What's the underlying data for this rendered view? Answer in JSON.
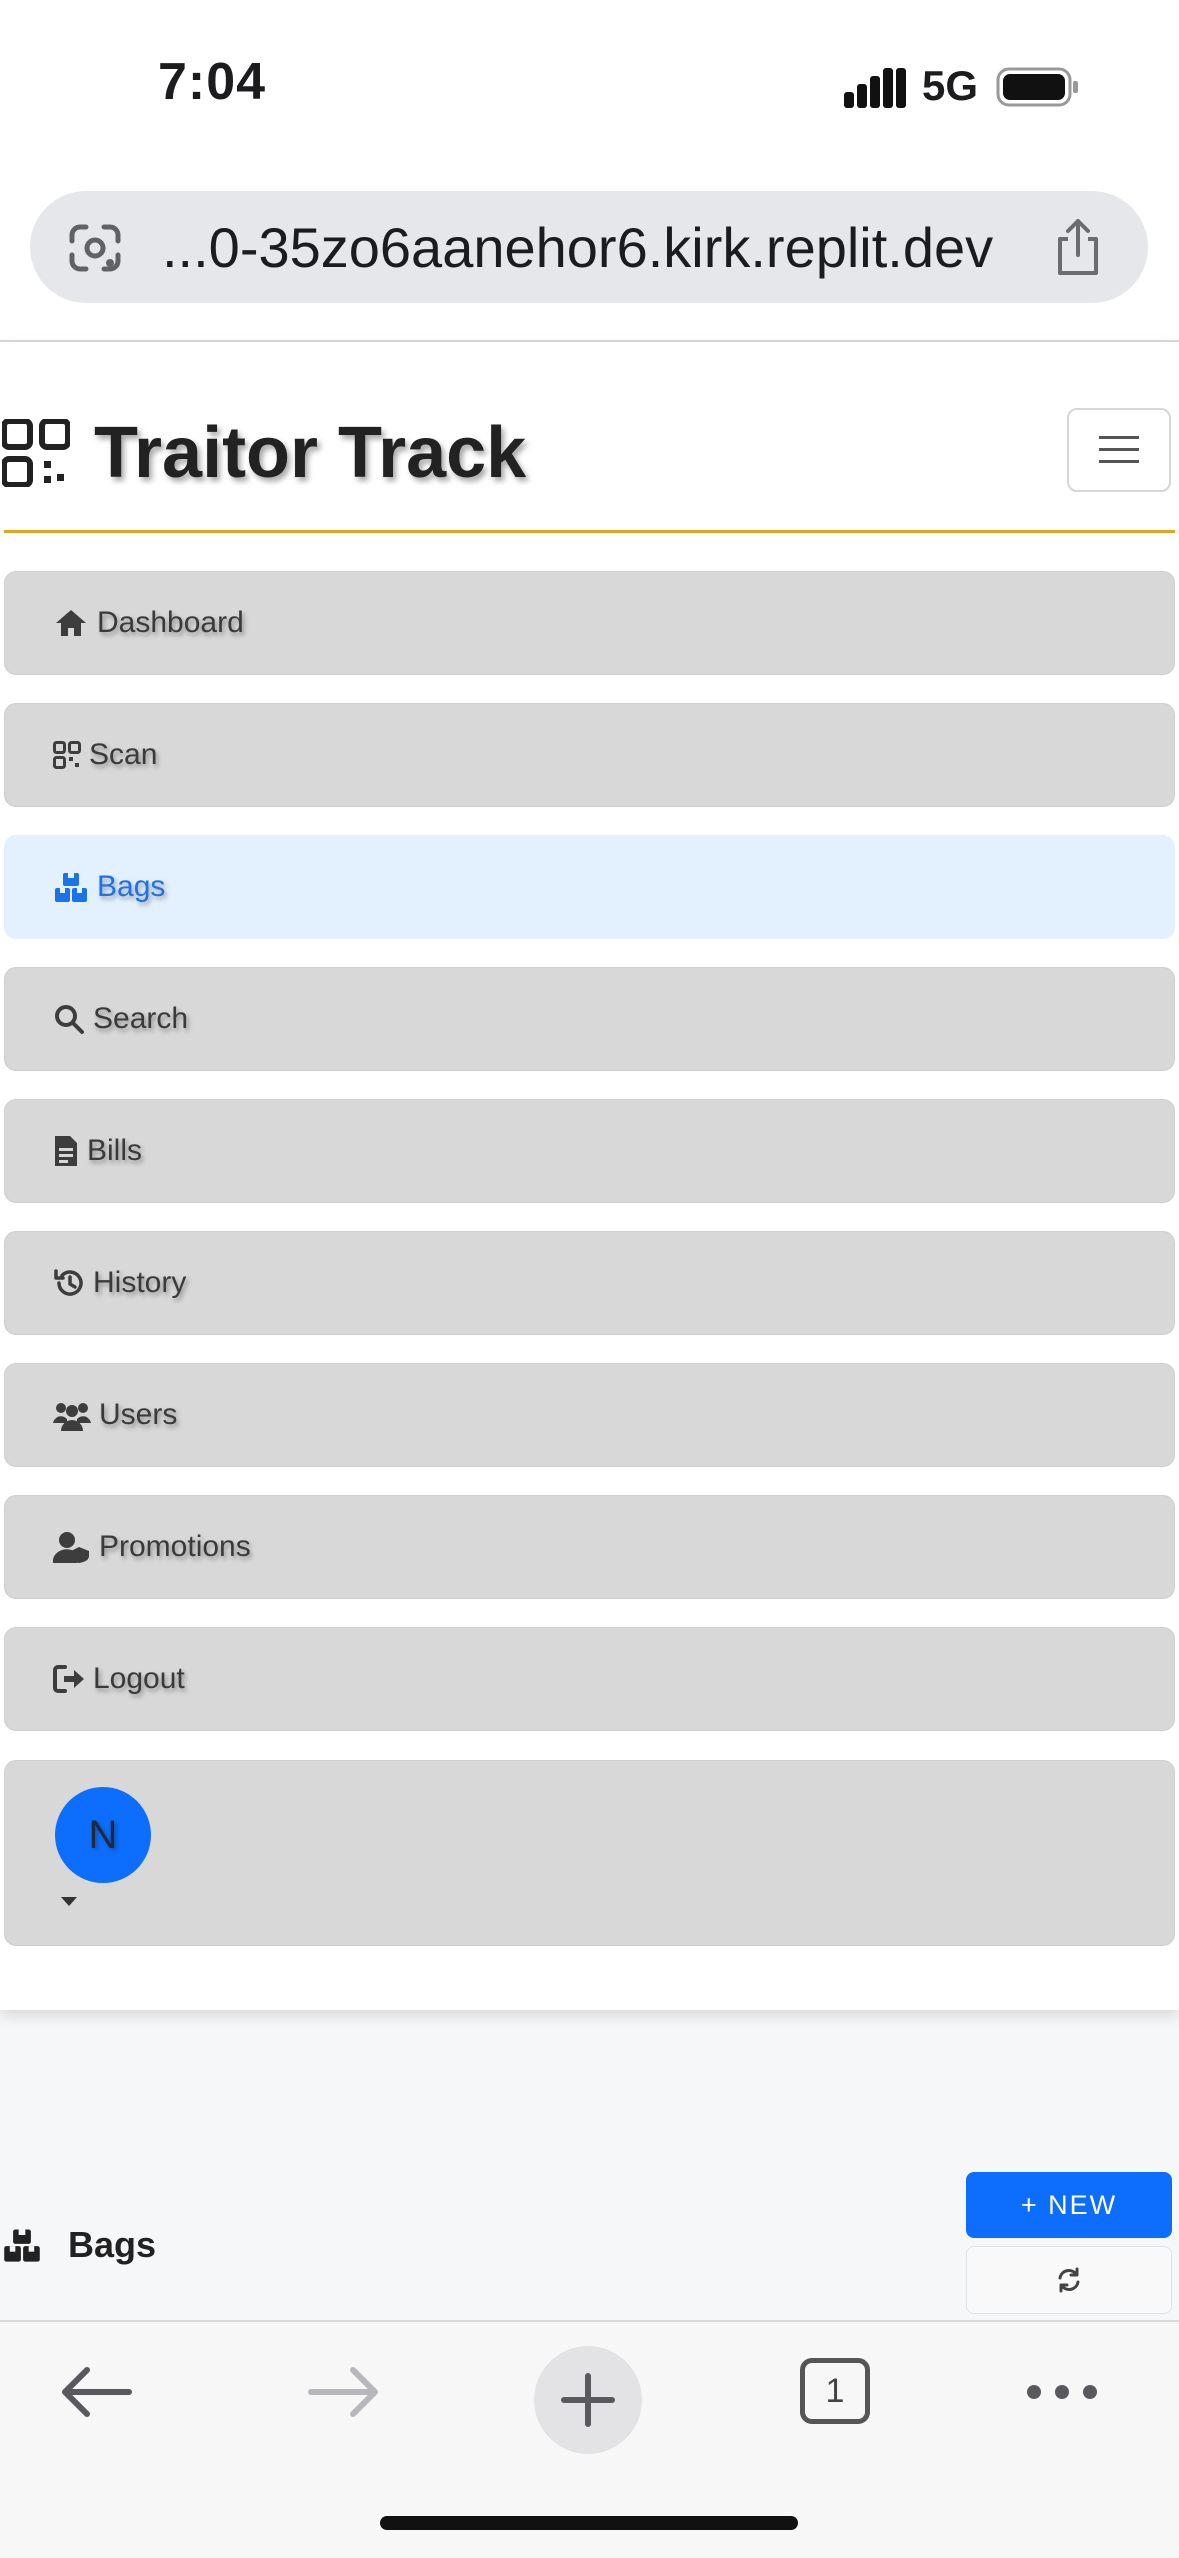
{
  "status_bar": {
    "time": "7:04",
    "network": "5G"
  },
  "browser": {
    "url": "...0-35zo6aanehor6.kirk.replit.dev",
    "tab_count": "1"
  },
  "app": {
    "title": "Traitor Track",
    "accent_color": "#e0a521",
    "active_color": "#1a73e8"
  },
  "nav": {
    "items": [
      {
        "label": "Dashboard",
        "icon": "home-icon",
        "active": false
      },
      {
        "label": "Scan",
        "icon": "qr-code-icon",
        "active": false
      },
      {
        "label": "Bags",
        "icon": "boxes-icon",
        "active": true
      },
      {
        "label": "Search",
        "icon": "search-icon",
        "active": false
      },
      {
        "label": "Bills",
        "icon": "file-invoice-icon",
        "active": false
      },
      {
        "label": "History",
        "icon": "history-icon",
        "active": false
      },
      {
        "label": "Users",
        "icon": "users-icon",
        "active": false
      },
      {
        "label": "Promotions",
        "icon": "user-shield-icon",
        "active": false
      },
      {
        "label": "Logout",
        "icon": "logout-icon",
        "active": false
      }
    ],
    "user": {
      "initial": "N"
    }
  },
  "page": {
    "title": "Bags",
    "new_button": "+ NEW"
  }
}
